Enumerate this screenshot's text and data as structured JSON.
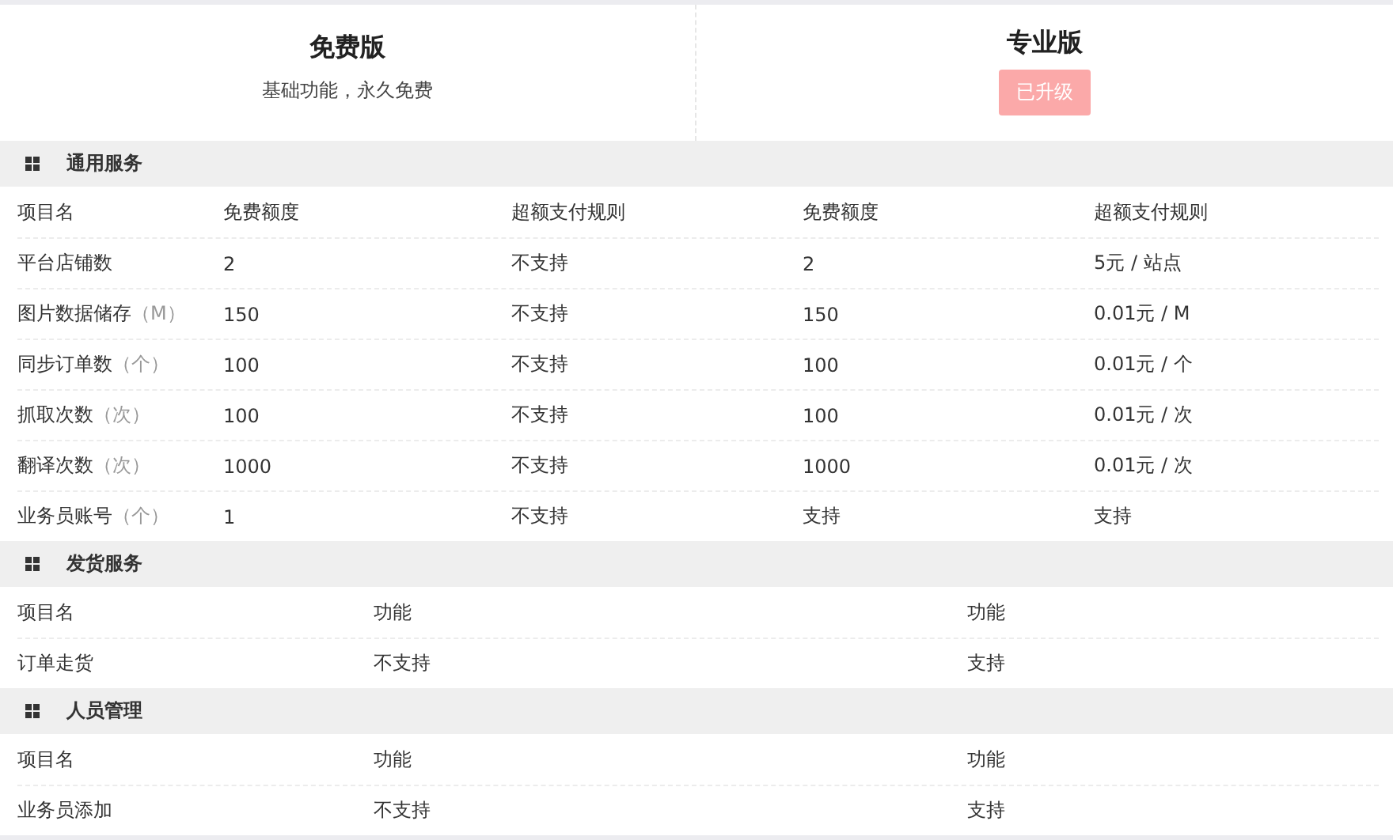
{
  "plans": [
    {
      "title": "免费版",
      "subtitle": "基础功能，永久免费"
    },
    {
      "title": "专业版",
      "button": {
        "label": "已升级",
        "disabled": true
      }
    }
  ],
  "sections": [
    {
      "title": "通用服务",
      "kind": "quota",
      "rows": [
        {
          "cells": [
            {
              "text": "项目名"
            },
            {
              "text": "免费额度"
            },
            {
              "text": "超额支付规则"
            },
            {
              "text": "免费额度"
            },
            {
              "text": "超额支付规则"
            }
          ]
        },
        {
          "cells": [
            {
              "text": "平台店铺数"
            },
            {
              "text": "2"
            },
            {
              "text": "不支持"
            },
            {
              "text": "2"
            },
            {
              "text": "5元 / 站点"
            }
          ]
        },
        {
          "cells": [
            {
              "text": "图片数据储存",
              "unit": "（M）"
            },
            {
              "text": "150"
            },
            {
              "text": "不支持"
            },
            {
              "text": "150"
            },
            {
              "text": "0.01元 / M"
            }
          ]
        },
        {
          "cells": [
            {
              "text": "同步订单数",
              "unit": "（个）"
            },
            {
              "text": "100"
            },
            {
              "text": "不支持"
            },
            {
              "text": "100"
            },
            {
              "text": "0.01元 / 个"
            }
          ]
        },
        {
          "cells": [
            {
              "text": "抓取次数",
              "unit": "（次）"
            },
            {
              "text": "100"
            },
            {
              "text": "不支持"
            },
            {
              "text": "100"
            },
            {
              "text": "0.01元 / 次"
            }
          ]
        },
        {
          "cells": [
            {
              "text": "翻译次数",
              "unit": "（次）"
            },
            {
              "text": "1000"
            },
            {
              "text": "不支持"
            },
            {
              "text": "1000"
            },
            {
              "text": "0.01元 / 次"
            }
          ]
        },
        {
          "cells": [
            {
              "text": "业务员账号",
              "unit": "（个）"
            },
            {
              "text": "1"
            },
            {
              "text": "不支持"
            },
            {
              "text": "支持"
            },
            {
              "text": "支持"
            }
          ]
        }
      ]
    },
    {
      "title": "发货服务",
      "kind": "feature",
      "rows": [
        {
          "cells": [
            {
              "text": "项目名"
            },
            {
              "text": "功能"
            },
            {
              "text": "功能"
            }
          ]
        },
        {
          "cells": [
            {
              "text": "订单走货"
            },
            {
              "text": "不支持"
            },
            {
              "text": "支持"
            }
          ]
        }
      ]
    },
    {
      "title": "人员管理",
      "kind": "feature",
      "rows": [
        {
          "cells": [
            {
              "text": "项目名"
            },
            {
              "text": "功能"
            },
            {
              "text": "功能"
            }
          ]
        },
        {
          "cells": [
            {
              "text": "业务员添加"
            },
            {
              "text": "不支持"
            },
            {
              "text": "支持"
            }
          ]
        }
      ]
    }
  ]
}
